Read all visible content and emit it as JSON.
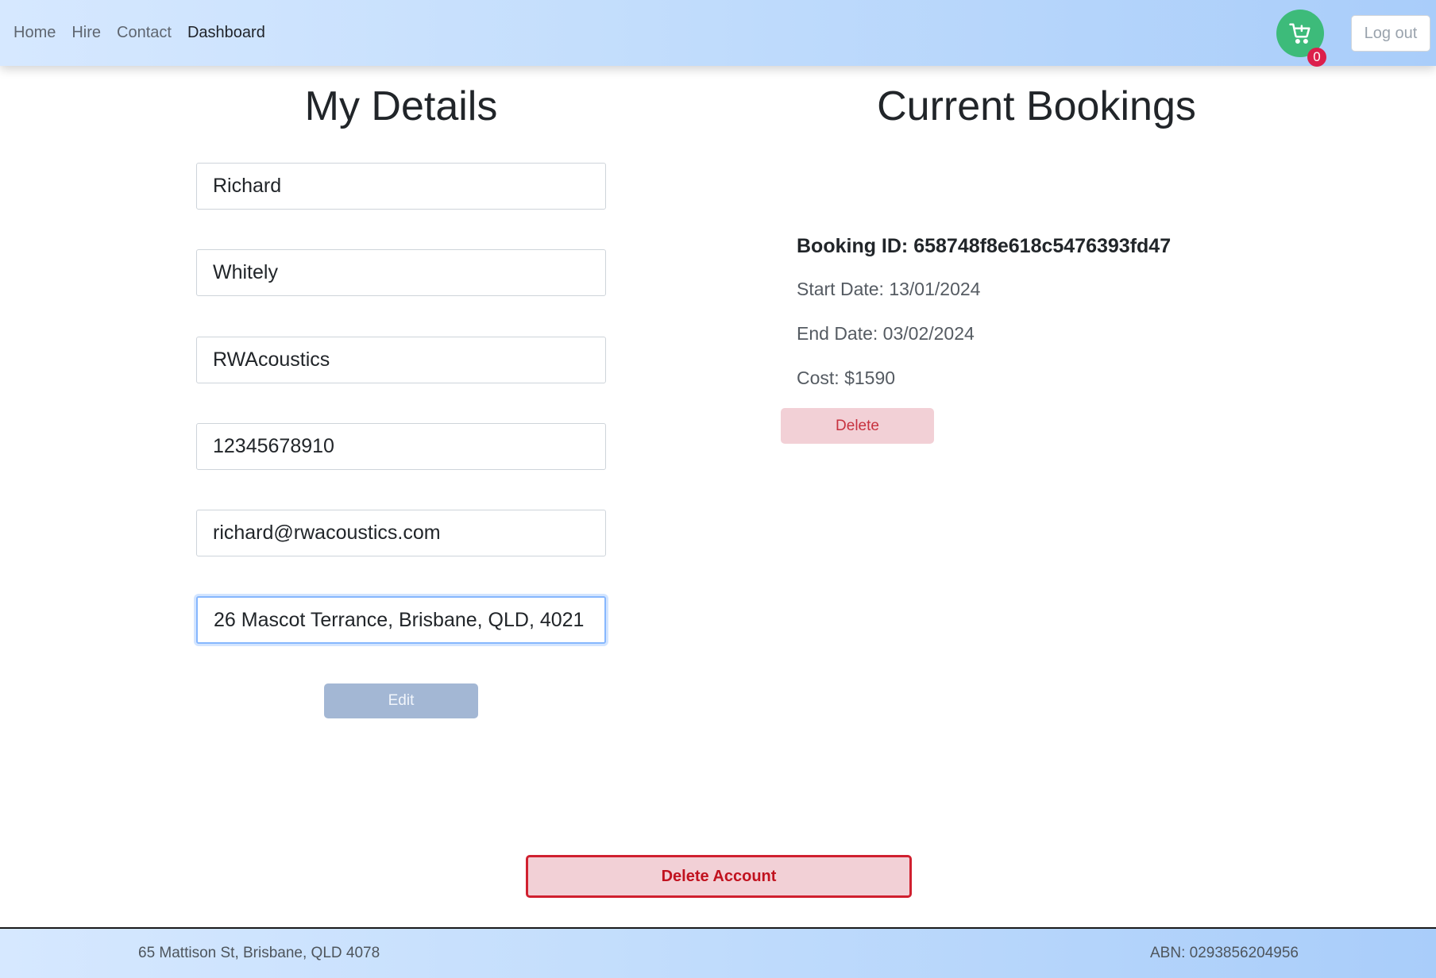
{
  "nav": {
    "links": [
      "Home",
      "Hire",
      "Contact",
      "Dashboard"
    ],
    "active": "Dashboard",
    "cart_count": "0",
    "logout_label": "Log out",
    "cart_icon": "cart-icon"
  },
  "details": {
    "title": "My Details",
    "first_name": "Richard",
    "last_name": "Whitely",
    "company": "RWAcoustics",
    "phone": "12345678910",
    "email": "richard@rwacoustics.com",
    "address": "26 Mascot Terrance, Brisbane, QLD, 4021",
    "edit_label": "Edit"
  },
  "bookings": {
    "title": "Current Bookings",
    "items": [
      {
        "id_label": "Booking ID: 658748f8e618c5476393fd47",
        "start": "Start Date: 13/01/2024",
        "end": "End Date: 03/02/2024",
        "cost": "Cost: $1590",
        "delete_label": "Delete"
      }
    ]
  },
  "account": {
    "delete_label": "Delete Account"
  },
  "footer": {
    "address": "65 Mattison St, Brisbane, QLD 4078",
    "abn": "ABN: 0293856204956"
  },
  "colors": {
    "nav_gradient_start": "#d6e8ff",
    "nav_gradient_end": "#a9cdfa",
    "cart_green": "#3dbb7a",
    "badge_red": "#dc1f4b",
    "danger_red": "#d0202f"
  }
}
